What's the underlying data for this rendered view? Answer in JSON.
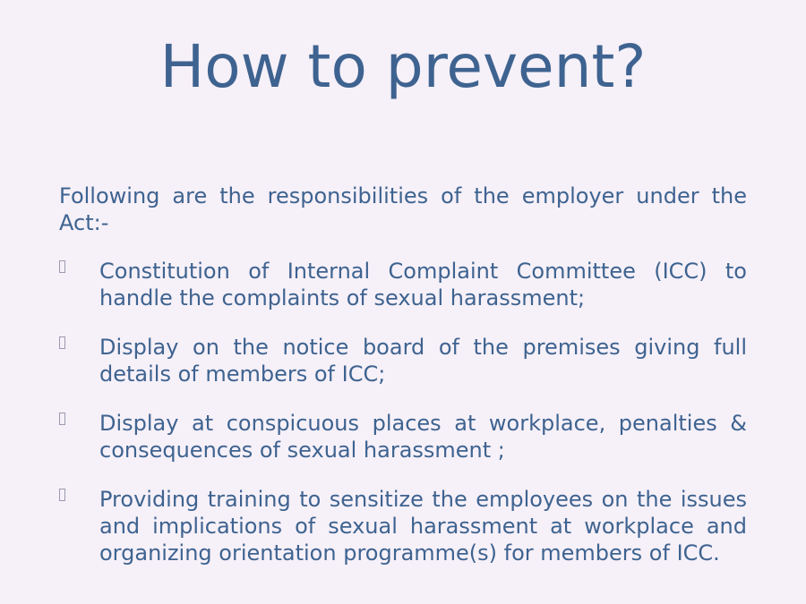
{
  "slide": {
    "title": "How to prevent?",
    "intro": "Following are the responsibilities of the employer under the Act:-",
    "bullets": [
      {
        "text": "Constitution of Internal Complaint Committee (ICC) to handle the complaints of sexual harassment;"
      },
      {
        "text": "Display on the notice board of the premises giving full details of members of ICC;"
      },
      {
        "text": "Display at conspicuous places at workplace, penalties & consequences of sexual harassment ;"
      },
      {
        "text": "Providing training to sensitize the employees on the issues and implications of sexual harassment at workplace and organizing orientation programme(s) for members of ICC."
      }
    ]
  },
  "colors": {
    "background": "#f6f0f8",
    "text": "#3e6390",
    "bullet_marker": "#9a9ab0"
  }
}
